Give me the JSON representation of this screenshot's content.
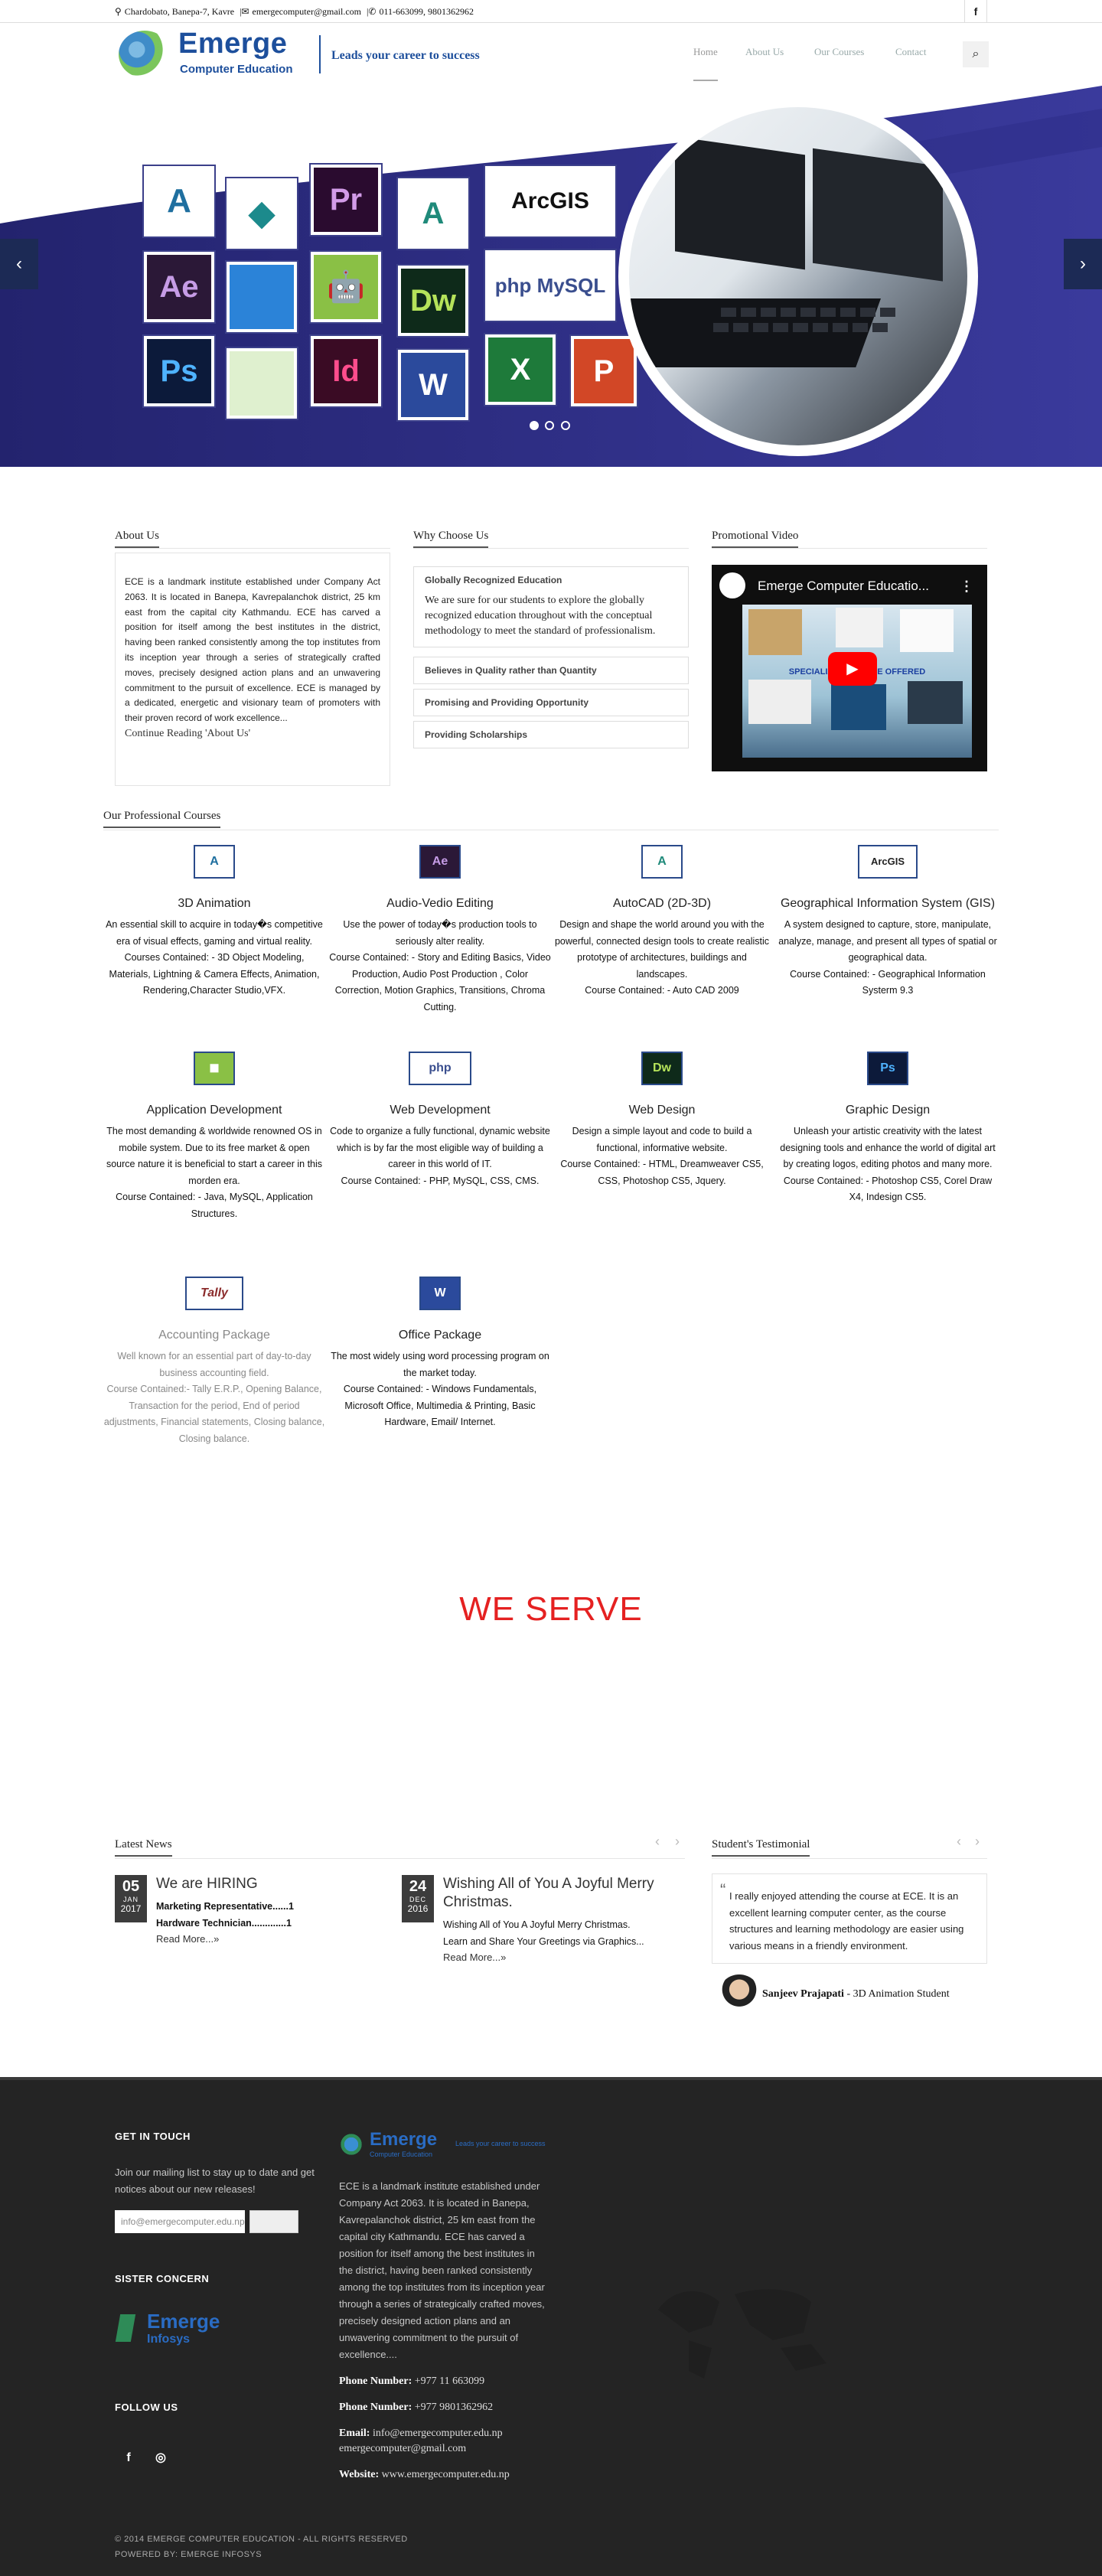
{
  "topbar": {
    "address": "Chardobato, Banepa-7, Kavre",
    "email": "emergecomputer@gmail.com",
    "phone": "011-663099, 9801362962",
    "fb_icon": "f"
  },
  "header": {
    "logo_name": "Emerge",
    "logo_sub": "Computer Education",
    "tagline": "Leads your career to success",
    "nav": [
      "Home",
      "About Us",
      "Our Courses",
      "Contact"
    ],
    "search_icon": "⌕"
  },
  "hero": {
    "prev": "‹",
    "next": "›",
    "tiles": [
      "A",
      "◆",
      "Pr",
      "A",
      "ArcGIS",
      "Ae",
      "",
      "🤖",
      "Dw",
      "php MySQL",
      "Ps",
      "",
      "Id",
      "W",
      "X",
      "P"
    ]
  },
  "about": {
    "title": "About Us",
    "text": "ECE is a landmark institute established under Company Act 2063. It is located in Banepa, Kavrepalanchok district, 25 km east from the capital city Kathmandu. ECE has carved a position for itself among the best institutes in the district, having been ranked consistently among the top institutes from its inception year through a series of strategically crafted moves, precisely designed action plans and an unwavering commitment to the pursuit of excellence. ECE is managed by a dedicated, energetic and visionary team of promoters with their proven record of work excellence...",
    "more": "Continue Reading 'About Us'"
  },
  "why": {
    "title": "Why Choose Us",
    "items": [
      {
        "title": "Globally Recognized Education",
        "body": "We are sure for our students to explore the globally recognized education throughout with the conceptual methodology to meet the standard of professionalism."
      },
      {
        "title": "Believes in Quality rather than Quantity"
      },
      {
        "title": "Promising and Providing Opportunity"
      },
      {
        "title": "Providing Scholarships"
      }
    ]
  },
  "video": {
    "title": "Promotional Video",
    "video_title": "Emerge Computer Educatio...",
    "banner": "SPECIALIZED COURSE OFFERED",
    "labels": [
      "3D Animation",
      "Office Package",
      "Web Development",
      "App Development",
      "VFX"
    ]
  },
  "courses": {
    "title": "Our Professional Courses",
    "items": [
      {
        "icon": "A",
        "title": "3D Animation",
        "desc": "An essential skill to acquire in today�s competitive era of visual effects, gaming and virtual reality.\nCourses Contained: - 3D Object Modeling, Materials, Lightning & Camera Effects, Animation, Rendering,Character Studio,VFX."
      },
      {
        "icon": "Ae",
        "title": "Audio-Vedio Editing",
        "desc": "Use the power of today�s production tools to seriously alter reality.\nCourse Contained: - Story and Editing Basics, Video Production, Audio Post Production , Color Correction, Motion Graphics, Transitions, Chroma Cutting."
      },
      {
        "icon": "A",
        "title": "AutoCAD (2D-3D)",
        "desc": "Design and shape the world around you with the powerful, connected design tools to create realistic prototype of architectures, buildings and landscapes.\nCourse Contained: - Auto CAD 2009"
      },
      {
        "icon": "ArcGIS",
        "title": "Geographical Information System (GIS)",
        "desc": "A system designed to capture, store, manipulate, analyze, manage, and present all types of spatial or geographical data.\nCourse Contained: - Geographical Information Systerm 9.3"
      },
      {
        "icon": "◼",
        "title": "Application Development",
        "desc": "The most demanding & worldwide renowned OS in mobile system. Due to its free market & open source nature it is beneficial to start a career in this morden era.\nCourse Contained: - Java, MySQL, Application Structures."
      },
      {
        "icon": "php",
        "title": "Web Development",
        "desc": "Code to organize a fully functional, dynamic website which is by far the most eligible way of building a career in this world of IT.\nCourse Contained: - PHP, MySQL, CSS, CMS."
      },
      {
        "icon": "Dw",
        "title": "Web Design",
        "desc": "Design a simple layout and code to build a functional, informative website.\nCourse Contained: - HTML, Dreamweaver CS5, CSS, Photoshop CS5, Jquery."
      },
      {
        "icon": "Ps",
        "title": "Graphic Design",
        "desc": "Unleash your artistic creativity with the latest designing tools and enhance the world of digital art by creating logos, editing photos and many more.\nCourse Contained: - Photoshop CS5, Corel Draw X4, Indesign CS5."
      },
      {
        "icon": "Tally",
        "title": "Accounting Package",
        "desc": "Well known for an essential part of day-to-day business accounting field.\nCourse Contained:- Tally E.R.P., Opening Balance, Transaction for the period, End of period adjustments, Financial statements, Closing balance, Closing balance."
      },
      {
        "icon": "W",
        "title": "Office Package",
        "desc": "The most widely using word processing program on the market today.\nCourse Contained: - Windows Fundamentals, Microsoft Office, Multimedia & Printing, Basic Hardware, Email/ Internet."
      }
    ]
  },
  "we_serve": "WE SERVE",
  "news": {
    "title": "Latest News",
    "prev": "‹",
    "next": "›",
    "items": [
      {
        "day": "05",
        "month": "JAN",
        "year": "2017",
        "title": "We are HIRING",
        "lines": [
          "Marketing Representative......1",
          "Hardware Technician.............1"
        ],
        "more": "Read More...»"
      },
      {
        "day": "24",
        "month": "DEC",
        "year": "2016",
        "title": "Wishing All of You A Joyful Merry Christmas.",
        "lines": [
          "Wishing All of You A Joyful Merry Christmas.",
          "Learn and Share Your Greetings via Graphics..."
        ],
        "more": "Read More...»"
      }
    ]
  },
  "testimonial": {
    "title": "Student's Testimonial",
    "quote": "I really enjoyed attending the course at ECE. It is an excellent learning computer center, as the course structures and learning methodology are easier using various means in a friendly environment.",
    "name": "Sanjeev Prajapati",
    "role": "- 3D Animation Student"
  },
  "footer": {
    "get_in_touch": "GET IN TOUCH",
    "mailing": "Join our mailing list to stay up to date and get notices about our new releases!",
    "email_value": "info@emergecomputer.edu.np",
    "sister": "SISTER CONCERN",
    "sister_name": "Emerge",
    "sister_sub": "Infosys",
    "follow": "FOLLOW US",
    "fb": "f",
    "ig": "◎",
    "logo_name": "Emerge",
    "logo_sub": "Computer Education",
    "logo_tag": "Leads your career to success",
    "about": "ECE is a landmark institute established under Company Act 2063. It is located in Banepa, Kavrepalanchok district, 25 km east from the capital city Kathmandu. ECE has carved a position for itself among the best institutes in the district, having been ranked consistently among the top institutes from its inception year through a series of strategically crafted moves, precisely designed action plans and an unwavering commitment to the pursuit of excellence....",
    "phone_label": "Phone Number:",
    "phone1": "+977 11 663099",
    "phone2": "+977 9801362962",
    "email_label": "Email:",
    "email1": "info@emergecomputer.edu.np",
    "email2": "emergecomputer@gmail.com",
    "web_label": "Website:",
    "website": "www.emergecomputer.edu.np",
    "copyright": "© 2014 EMERGE COMPUTER EDUCATION - ALL RIGHTS RESERVED",
    "powered": "POWERED BY: EMERGE INFOSYS"
  }
}
